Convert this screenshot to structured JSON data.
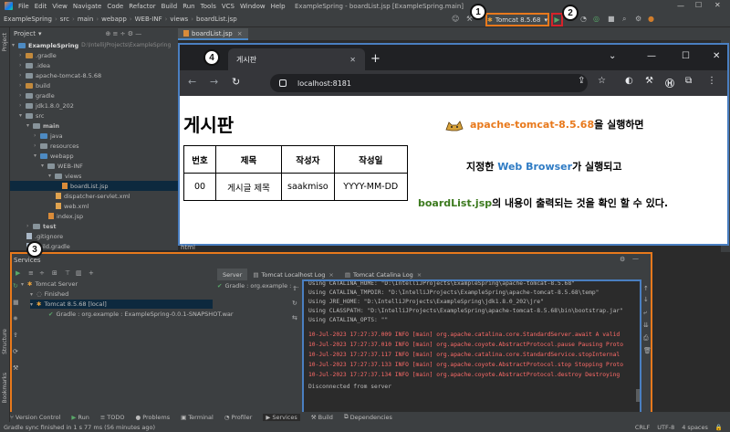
{
  "menu": {
    "items": [
      "File",
      "Edit",
      "View",
      "Navigate",
      "Code",
      "Refactor",
      "Build",
      "Run",
      "Tools",
      "VCS",
      "Window",
      "Help"
    ],
    "window_title": "ExampleSpring - boardList.jsp [ExampleSpring.main]"
  },
  "breadcrumb": [
    "ExampleSpring",
    "src",
    "main",
    "webapp",
    "WEB-INF",
    "views",
    "boardList.jsp"
  ],
  "toolbar": {
    "run_config": "Tomcat 8.5.68"
  },
  "annotations": {
    "one": "1",
    "two": "2",
    "three": "3",
    "four": "4"
  },
  "left_stripe": {
    "project": "Project",
    "structure": "Structure",
    "bookmarks": "Bookmarks"
  },
  "project_panel": {
    "title": "Project",
    "tree": [
      {
        "label": "ExampleSpring",
        "suffix": "D:\\IntelliJProjects\\ExampleSpring"
      },
      {
        "label": ".gradle"
      },
      {
        "label": ".idea"
      },
      {
        "label": "apache-tomcat-8.5.68"
      },
      {
        "label": "build"
      },
      {
        "label": "gradle"
      },
      {
        "label": "jdk1.8.0_202"
      },
      {
        "label": "src"
      },
      {
        "label": "main"
      },
      {
        "label": "java"
      },
      {
        "label": "resources"
      },
      {
        "label": "webapp"
      },
      {
        "label": "WEB-INF"
      },
      {
        "label": "views"
      },
      {
        "label": "boardList.jsp"
      },
      {
        "label": "dispatcher-servlet.xml"
      },
      {
        "label": "web.xml"
      },
      {
        "label": "index.jsp"
      },
      {
        "label": "test"
      },
      {
        "label": ".gitignore"
      },
      {
        "label": "build.gradle"
      }
    ]
  },
  "editor": {
    "tab": "boardList.jsp",
    "footer_tag": "html"
  },
  "browser": {
    "tab_title": "게시판",
    "url": "localhost:8181",
    "page": {
      "heading": "게시판",
      "table": {
        "headers": [
          "번호",
          "제목",
          "작성자",
          "작성일"
        ],
        "rows": [
          [
            "00",
            "게시글 제목",
            "saakmiso",
            "YYYY-MM-DD"
          ]
        ]
      },
      "notes": {
        "line1_highlight": "apache-tomcat-8.5.68",
        "line1_rest": "을 실행하면",
        "line2_pre": "지정한 ",
        "line2_highlight": "Web Browser",
        "line2_rest": "가 실행되고",
        "line3_highlight": "boardList.jsp",
        "line3_rest": "의 내용이 출력되는 것을 확인 할 수 있다."
      }
    }
  },
  "services": {
    "title": "Services",
    "tree": [
      {
        "label": "Tomcat Server"
      },
      {
        "label": "Finished"
      },
      {
        "label": "Tomcat 8.5.68 [local]"
      },
      {
        "label": "Gradle : org.example : ExampleSpring-0.0.1-SNAPSHOT.war"
      }
    ],
    "tabs": [
      "Server",
      "Tomcat Localhost Log",
      "Tomcat Catalina Log"
    ],
    "deployment": "Gradle : org.example : ...",
    "console": [
      {
        "text": "Using CATALINA_HOME:   \"D:\\IntelliJProjects\\ExampleSpring\\apache-tomcat-8.5.68\"",
        "type": "info"
      },
      {
        "text": "Using CATALINA_TMPDIR: \"D:\\IntelliJProjects\\ExampleSpring\\apache-tomcat-8.5.68\\temp\"",
        "type": "info"
      },
      {
        "text": "Using JRE_HOME:        \"D:\\IntelliJProjects\\ExampleSpring\\jdk1.8.0_202\\jre\"",
        "type": "info"
      },
      {
        "text": "Using CLASSPATH:       \"D:\\IntelliJProjects\\ExampleSpring\\apache-tomcat-8.5.68\\bin\\bootstrap.jar\"",
        "type": "info"
      },
      {
        "text": "Using CATALINA_OPTS:   \"\"",
        "type": "info"
      },
      {
        "text": "10-Jul-2023 17:27:37.009 INFO [main] org.apache.catalina.core.StandardServer.await A valid",
        "type": "err"
      },
      {
        "text": "10-Jul-2023 17:27:37.010 INFO [main] org.apache.coyote.AbstractProtocol.pause Pausing Proto",
        "type": "err"
      },
      {
        "text": "10-Jul-2023 17:27:37.117 INFO [main] org.apache.catalina.core.StandardService.stopInternal",
        "type": "err"
      },
      {
        "text": "10-Jul-2023 17:27:37.133 INFO [main] org.apache.coyote.AbstractProtocol.stop Stopping Proto",
        "type": "err"
      },
      {
        "text": "10-Jul-2023 17:27:37.134 INFO [main] org.apache.coyote.AbstractProtocol.destroy Destroying",
        "type": "err"
      },
      {
        "text": "Disconnected from server",
        "type": "info"
      }
    ]
  },
  "bottom_tools": [
    "Version Control",
    "Run",
    "TODO",
    "Problems",
    "Terminal",
    "Profiler",
    "Services",
    "Build",
    "Dependencies"
  ],
  "status": {
    "message": "Gradle sync finished in 1 s 77 ms (56 minutes ago)",
    "right": [
      "CRLF",
      "UTF-8",
      "4 spaces"
    ]
  },
  "colors": {
    "accent_orange": "#e8791c",
    "accent_blue": "#4a7fc1",
    "run_red": "#d6232a",
    "log_red": "#ff6b68"
  }
}
